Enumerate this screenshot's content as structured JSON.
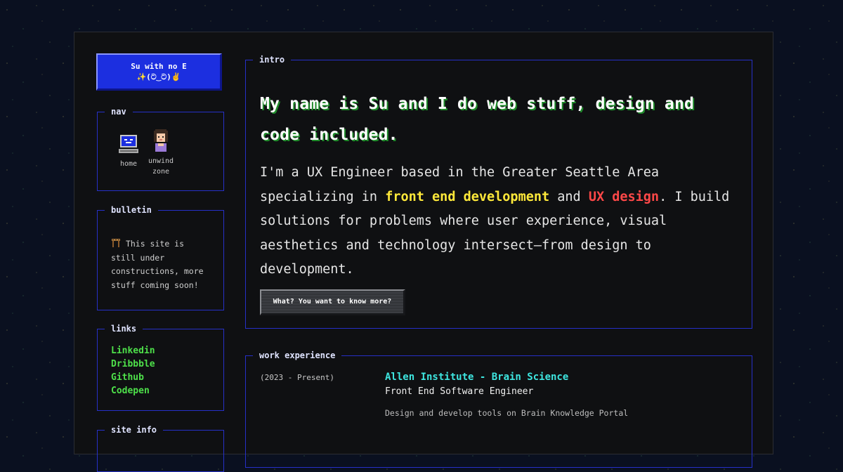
{
  "brand": {
    "name": "Su with no E",
    "emoticon": "✨(ට‿ට)✌️"
  },
  "nav": {
    "legend": "nav",
    "items": [
      {
        "label": "home",
        "icon": "computer-icon"
      },
      {
        "label": "unwind zone",
        "icon": "avatar-icon"
      }
    ]
  },
  "bulletin": {
    "legend": "bulletin",
    "icon": "construction-icon",
    "text": "This site is still under constructions, more stuff coming soon!"
  },
  "links": {
    "legend": "links",
    "items": [
      "Linkedin",
      "Dribbble",
      "Github",
      "Codepen"
    ]
  },
  "site_info": {
    "legend": "site info"
  },
  "intro": {
    "legend": "intro",
    "headline": "My name is Su and I do web stuff, design and code included.",
    "bio_part1": "I'm a UX Engineer based in the Greater Seattle Area specializing in ",
    "highlight1": "front end development",
    "bio_part2": " and ",
    "highlight2": "UX design",
    "bio_part3": ". I build solutions for problems where user experience, visual aesthetics and technology intersect—from design to development.",
    "button_label": "What? You want to know more?"
  },
  "work": {
    "legend": "work experience",
    "jobs": [
      {
        "date": "(2023 - Present)",
        "company": "Allen Institute - Brain Science",
        "title": "Front End Software Engineer",
        "description": "Design and develop tools on Brain Knowledge Portal"
      }
    ]
  },
  "colors": {
    "frame_blue": "#2630c8",
    "brand_blue": "#1c2fe0",
    "link_green": "#4ee04a",
    "highlight_yellow": "#ffe93a",
    "highlight_red": "#ff4848",
    "company_cyan": "#3ee6e0"
  }
}
